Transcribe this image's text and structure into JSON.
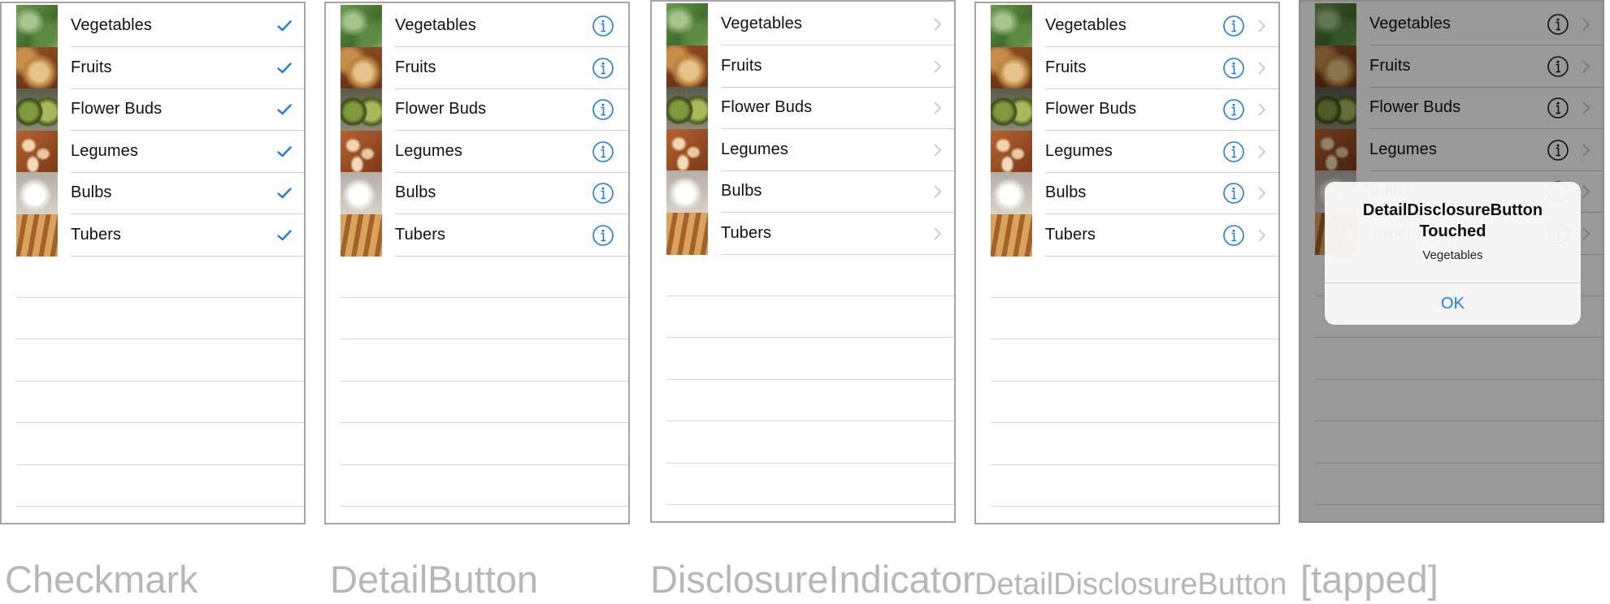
{
  "items": [
    "Vegetables",
    "Fruits",
    "Flower Buds",
    "Legumes",
    "Bulbs",
    "Tubers"
  ],
  "panels": [
    {
      "caption": "Checkmark"
    },
    {
      "caption": "DetailButton"
    },
    {
      "caption": "DisclosureIndicator"
    },
    {
      "caption": "DetailDisclosureButton"
    },
    {
      "caption": "[tapped]"
    }
  ],
  "alert": {
    "title": "DetailDisclosureButton Touched",
    "message": "Vegetables",
    "ok_label": "OK"
  },
  "colors": {
    "accent": "#1a7cf5",
    "chevron": "#c7c7cc",
    "separator": "#cfcfd3",
    "caption": "#b7b7b7"
  },
  "icons": {
    "checkmark": "checkmark-icon",
    "detail": "info-circle-icon",
    "disclosure": "chevron-right-icon"
  }
}
